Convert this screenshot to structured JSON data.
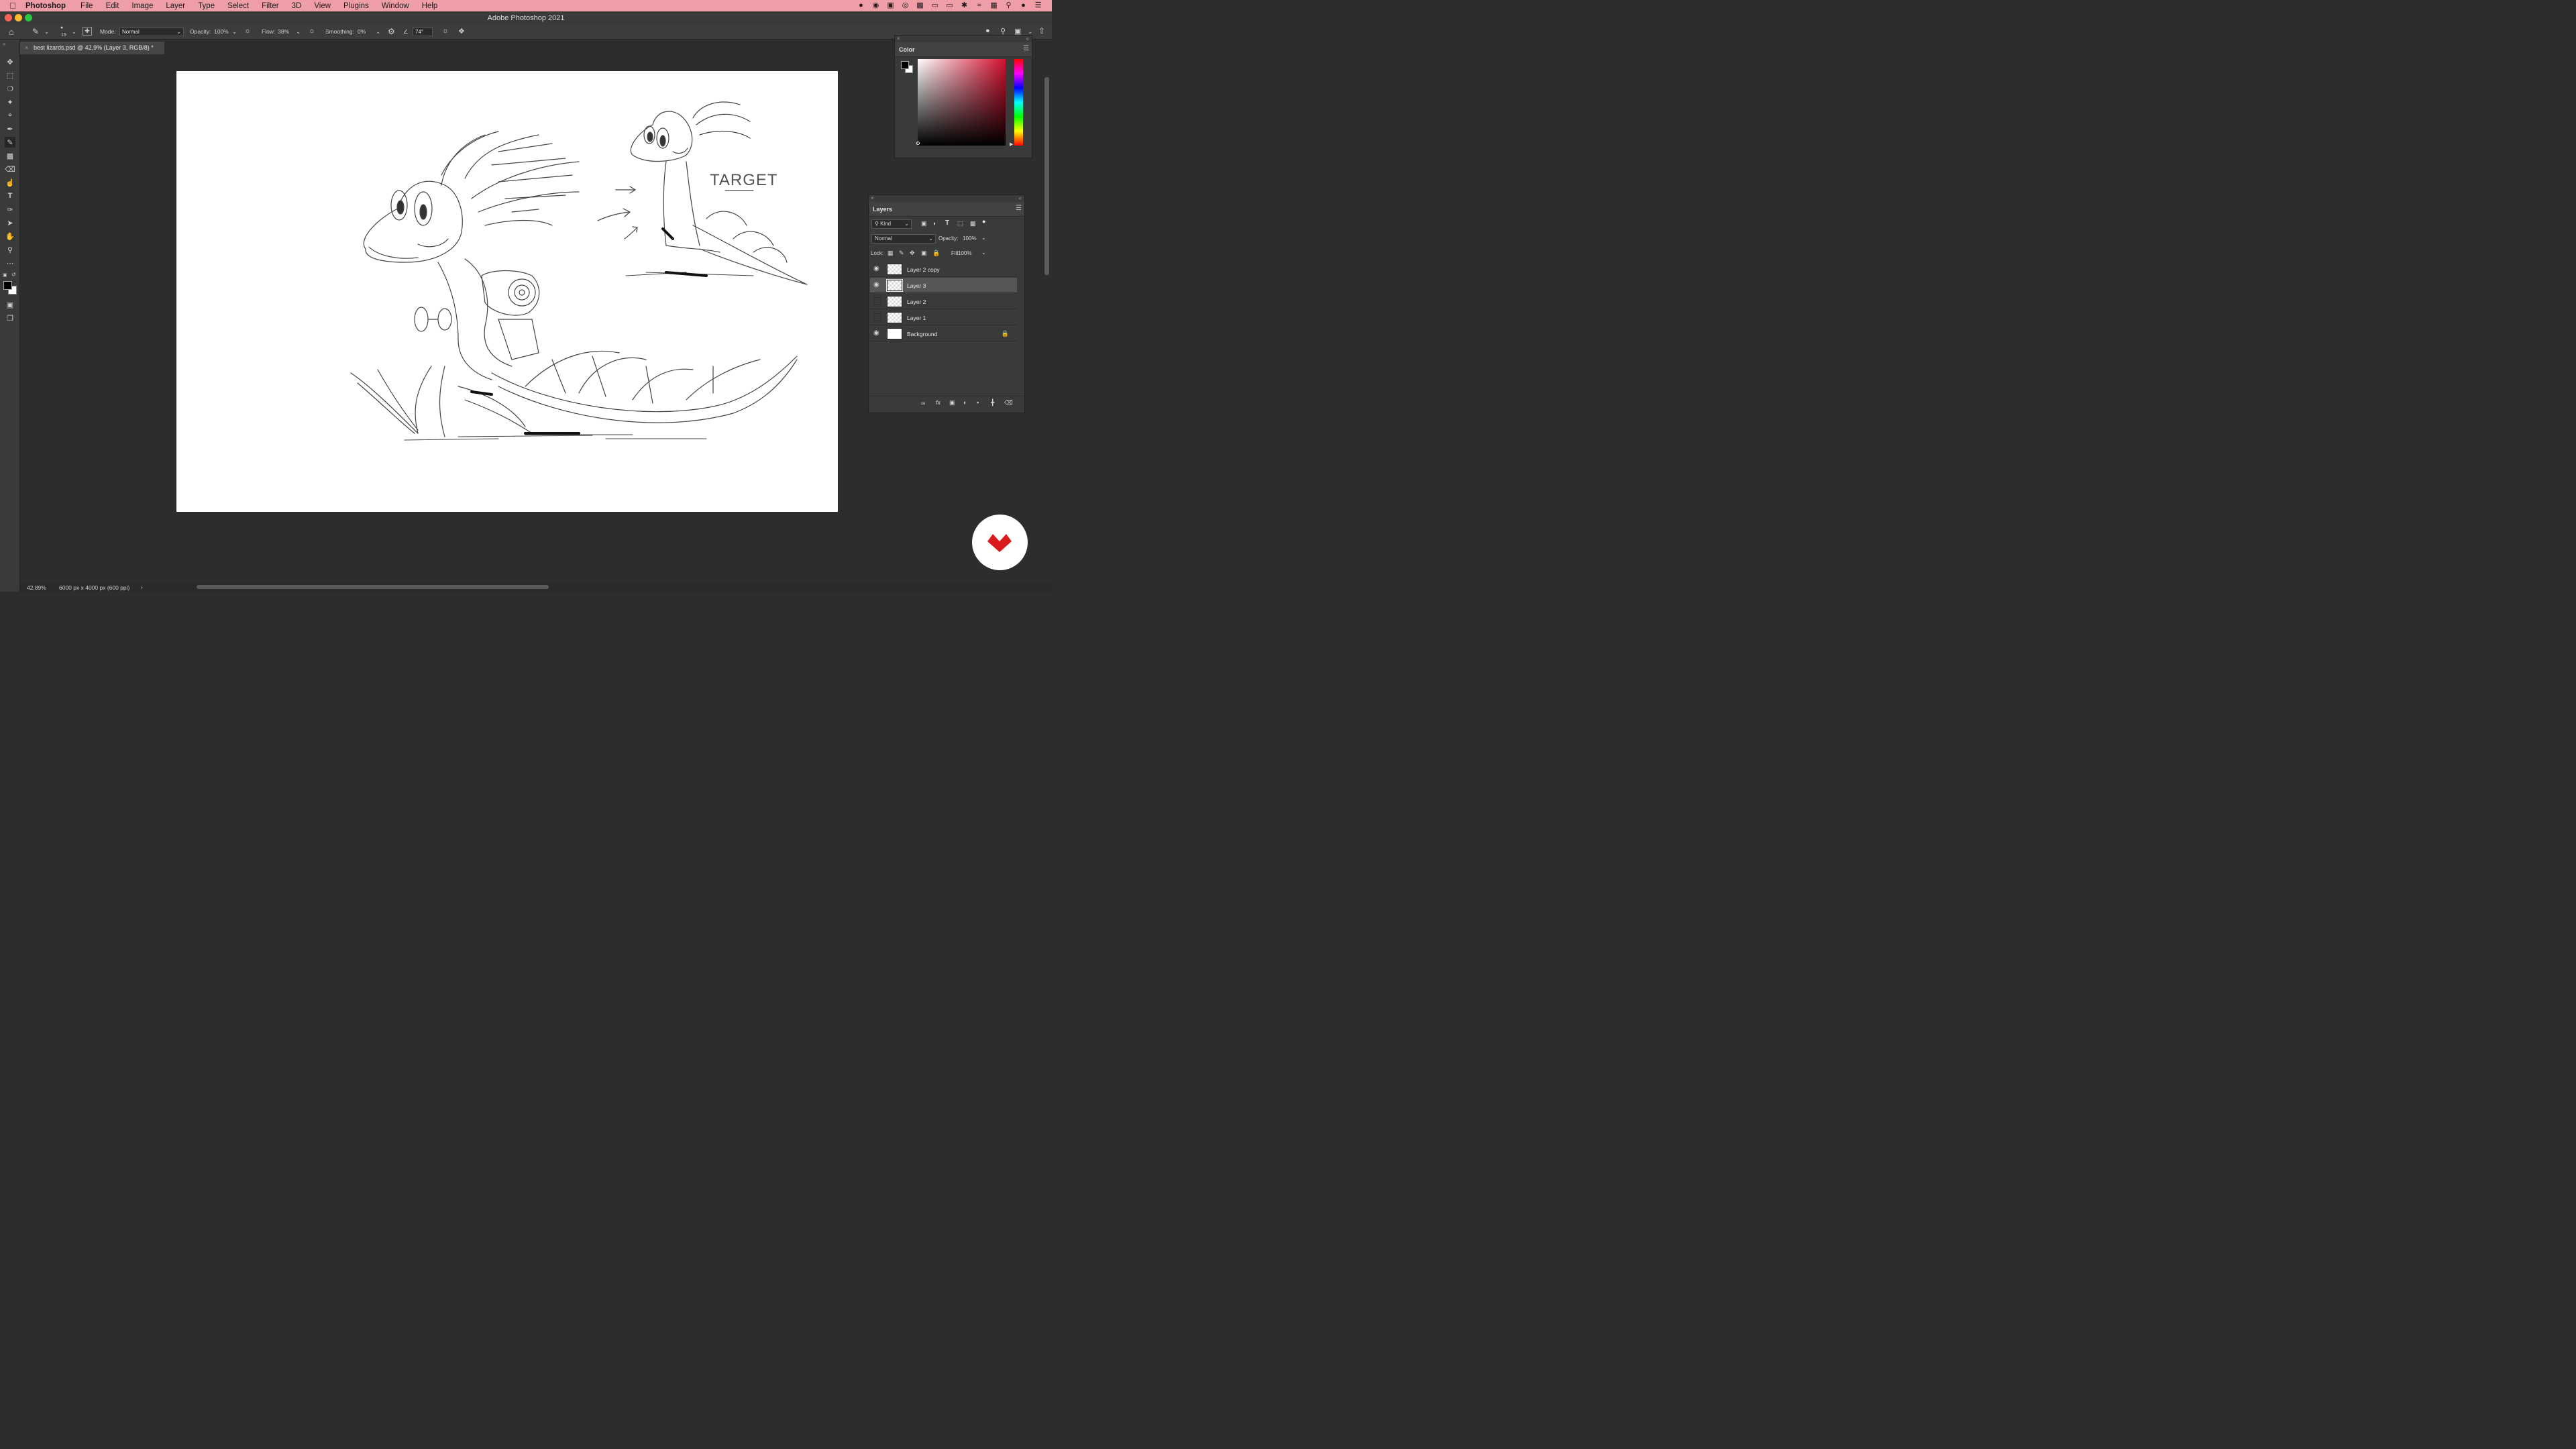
{
  "menubar": {
    "app": "Photoshop",
    "items": [
      "File",
      "Edit",
      "Image",
      "Layer",
      "Type",
      "Select",
      "Filter",
      "3D",
      "View",
      "Plugins",
      "Window",
      "Help"
    ]
  },
  "window": {
    "title": "Adobe Photoshop 2021"
  },
  "options": {
    "brush_size": "15",
    "mode_label": "Mode:",
    "mode_value": "Normal",
    "opacity_label": "Opacity:",
    "opacity_value": "100%",
    "flow_label": "Flow:",
    "flow_value": "38%",
    "smoothing_label": "Smoothing:",
    "smoothing_value": "0%",
    "angle_value": "74°"
  },
  "document": {
    "tab_title": "best lizards.psd @ 42,9% (Layer 3, RGB/8) *",
    "canvas_text": "TARGET"
  },
  "status": {
    "zoom": "42,89%",
    "doc_info": "6000 px x 4000 px (600 ppi)"
  },
  "color_panel": {
    "title": "Color",
    "foreground": "#000000",
    "background": "#ffffff"
  },
  "layers_panel": {
    "title": "Layers",
    "filter_kind": "Kind",
    "blend_mode": "Normal",
    "opacity_label": "Opacity:",
    "opacity_value": "100%",
    "lock_label": "Lock:",
    "fill_label": "Fill:",
    "fill_value": "100%",
    "layers": [
      {
        "name": "Layer 2 copy",
        "visible": true,
        "selected": false,
        "locked": false
      },
      {
        "name": "Layer 3",
        "visible": true,
        "selected": true,
        "locked": false
      },
      {
        "name": "Layer 2",
        "visible": false,
        "selected": false,
        "locked": false
      },
      {
        "name": "Layer 1",
        "visible": false,
        "selected": false,
        "locked": false
      },
      {
        "name": "Background",
        "visible": true,
        "selected": false,
        "locked": true
      }
    ]
  },
  "colors": {
    "menubar_bg": "#ef9ea8",
    "hue_top": "#d40f2e"
  }
}
